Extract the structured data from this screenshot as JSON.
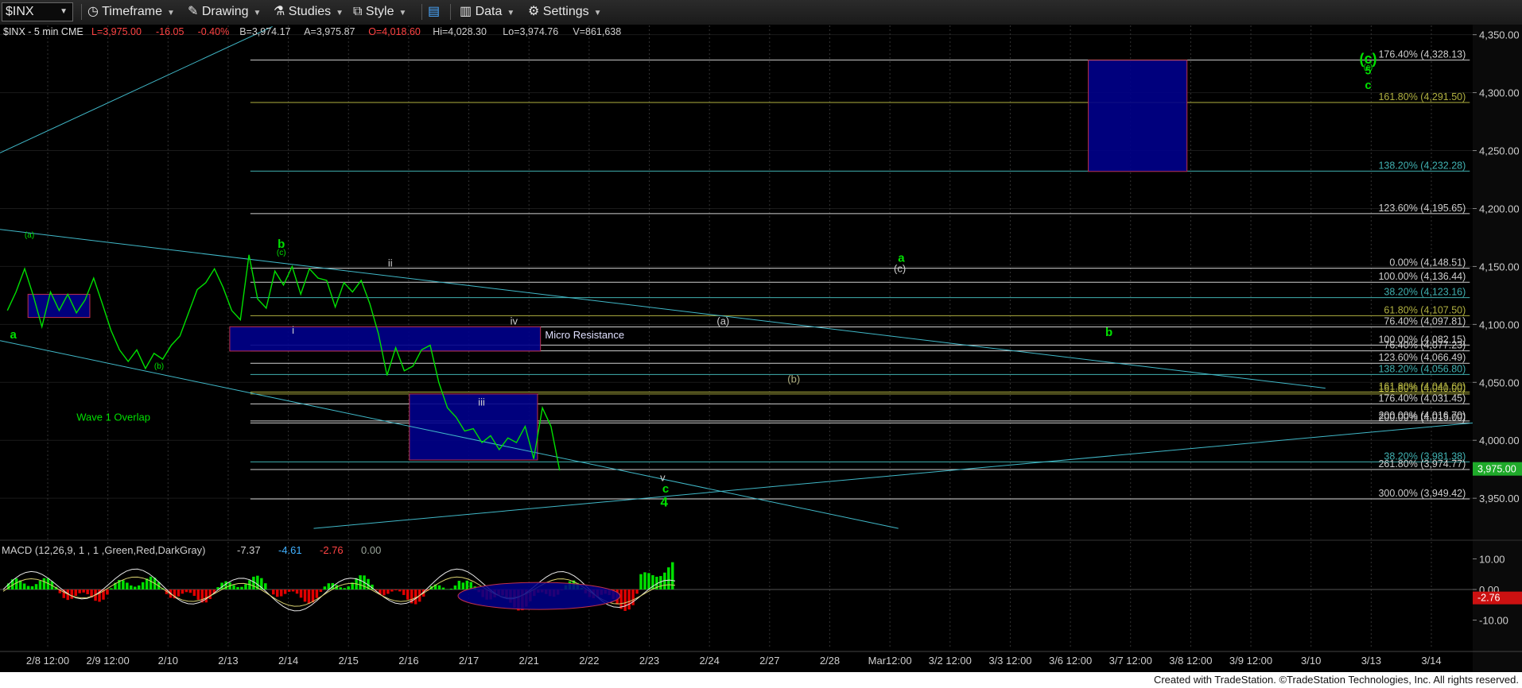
{
  "toolbar": {
    "symbol": "$INX",
    "timeframe": "Timeframe",
    "drawing": "Drawing",
    "studies": "Studies",
    "style": "Style",
    "data": "Data",
    "settings": "Settings"
  },
  "header": {
    "title": "$INX - 5 min  CME",
    "last": "L=3,975.00",
    "change": "-16.05",
    "pct": "-0.40%",
    "bid": "B=3,974.17",
    "ask": "A=3,975.87",
    "open": "O=4,018.60",
    "hi": "Hi=4,028.30",
    "lo": "Lo=3,974.76",
    "vol": "V=861,638"
  },
  "colors": {
    "price": "#00e000",
    "fib_white": "#cfcfcf",
    "fib_olive": "#b0b040",
    "fib_teal": "#40b0b0",
    "box": "#00008b",
    "trend": "#40b8c8",
    "macd_pos": "#00e000",
    "macd_neg": "#e00000"
  },
  "chart_data": {
    "type": "line",
    "series": [
      {
        "name": "$INX",
        "values": [
          4112,
          4128,
          4148,
          4125,
          4098,
          4128,
          4112,
          4126,
          4110,
          4121,
          4140,
          4118,
          4095,
          4078,
          4068,
          4078,
          4062,
          4075,
          4070,
          4082,
          4090,
          4110,
          4130,
          4136,
          4148,
          4132,
          4112,
          4104,
          4160,
          4122,
          4114,
          4146,
          4134,
          4150,
          4126,
          4148,
          4140,
          4138,
          4115,
          4136,
          4128,
          4138,
          4118,
          4092,
          4056,
          4080,
          4060,
          4064,
          4078,
          4082,
          4050,
          4028,
          4020,
          4008,
          4010,
          3998,
          4004,
          3992,
          4002,
          3998,
          4012,
          3984,
          4028,
          4012,
          3974
        ]
      }
    ],
    "x_ticks": [
      "2/8 12:00",
      "2/9 12:00",
      "2/10",
      "2/13",
      "2/14",
      "2/15",
      "2/16",
      "2/17",
      "2/21",
      "2/22",
      "2/23",
      "2/24",
      "2/27",
      "2/28",
      "Mar12:00",
      "3/2 12:00",
      "3/3 12:00",
      "3/6 12:00",
      "3/7 12:00",
      "3/8 12:00",
      "3/9 12:00",
      "3/10",
      "3/13",
      "3/14"
    ],
    "y_ticks": [
      "4,350.00",
      "4,300.00",
      "4,250.00",
      "4,200.00",
      "4,150.00",
      "4,100.00",
      "4,050.00",
      "4,000.00",
      "3,950.00"
    ],
    "ylim": [
      3922,
      4358
    ],
    "last_price_label": "3,975.00",
    "fib_levels": [
      {
        "label": "176.40% (4,328.13)",
        "value": 4328.13,
        "color": "white"
      },
      {
        "label": "161.80% (4,291.50)",
        "value": 4291.5,
        "color": "olive"
      },
      {
        "label": "138.20% (4,232.28)",
        "value": 4232.28,
        "color": "teal"
      },
      {
        "label": "123.60% (4,195.65)",
        "value": 4195.65,
        "color": "white"
      },
      {
        "label": "0.00% (4,148.51)",
        "value": 4148.51,
        "color": "white"
      },
      {
        "label": "100.00% (4,136.44)",
        "value": 4136.44,
        "color": "white"
      },
      {
        "label": "38.20% (4,123.16)",
        "value": 4123.16,
        "color": "teal"
      },
      {
        "label": "61.80% (4,107.50)",
        "value": 4107.5,
        "color": "olive"
      },
      {
        "label": "76.40% (4,097.81)",
        "value": 4097.81,
        "color": "white"
      },
      {
        "label": "100.00% (4,082.15)",
        "value": 4082.15,
        "color": "white"
      },
      {
        "label": "76.40% (4,077.23)",
        "value": 4077.23,
        "color": "white"
      },
      {
        "label": "123.60% (4,066.49)",
        "value": 4066.49,
        "color": "white"
      },
      {
        "label": "138.20% (4,056.80)",
        "value": 4056.8,
        "color": "teal"
      },
      {
        "label": "161.80% (4,041.60)",
        "value": 4041.6,
        "color": "olive"
      },
      {
        "label": "161.80% (4,040.00)",
        "value": 4040.0,
        "color": "olive"
      },
      {
        "label": "176.40% (4,031.45)",
        "value": 4031.45,
        "color": "white"
      },
      {
        "label": "200.00% (4,016.70)",
        "value": 4016.7,
        "color": "white"
      },
      {
        "label": "200.00% (4,015.00)",
        "value": 4015.0,
        "color": "white"
      },
      {
        "label": "38.20% (3,981.38)",
        "value": 3981.38,
        "color": "teal"
      },
      {
        "label": "261.80% (3,974.77)",
        "value": 3974.77,
        "color": "white"
      },
      {
        "label": "300.00% (3,949.42)",
        "value": 3949.42,
        "color": "white"
      }
    ],
    "wave_labels_green": [
      "a",
      "b",
      "4",
      "b",
      "a",
      "Wave 1 Overlap",
      "5"
    ],
    "wave_labels_small": [
      "(a)",
      "(c)",
      "(b)",
      "(c)"
    ],
    "wave_labels_white": [
      "i",
      "ii",
      "iii",
      "iv",
      "v",
      "(a)",
      "(b)",
      "(c)"
    ],
    "wave_labels_green_minor": [
      "c",
      "c",
      "(c)"
    ],
    "annotations": [
      "Micro Resistance"
    ],
    "macd": {
      "title": "MACD (12,26,9, 1 , 1 ,Green,Red,DarkGray)",
      "values": [
        "-7.37",
        "-4.61",
        "-2.76",
        "0.00"
      ],
      "y_ticks": [
        "10.00",
        "0.00",
        "-10.00"
      ],
      "last_label": "-2.76"
    }
  },
  "footer": "Created with TradeStation. ©TradeStation Technologies, Inc. All rights reserved."
}
